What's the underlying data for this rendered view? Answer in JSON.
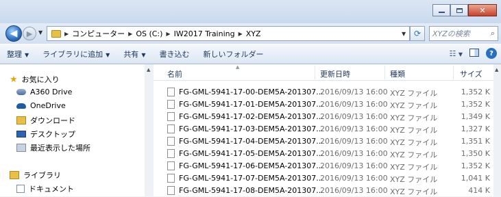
{
  "address": {
    "crumbs": [
      "コンピューター",
      "OS (C:)",
      "IW2017 Training",
      "XYZ"
    ],
    "search_placeholder": "XYZの検索"
  },
  "toolbar": {
    "organize": "整理",
    "add_to_library": "ライブラリに追加",
    "share": "共有",
    "burn": "書き込む",
    "new_folder": "新しいフォルダー"
  },
  "nav": {
    "favorites": "お気に入り",
    "a360": "A360 Drive",
    "onedrive": "OneDrive",
    "downloads": "ダウンロード",
    "desktop": "デスクトップ",
    "recent": "最近表示した場所",
    "libraries": "ライブラリ",
    "documents": "ドキュメント"
  },
  "columns": {
    "name": "名前",
    "modified": "更新日時",
    "type": "種類",
    "size": "サイズ"
  },
  "files": [
    {
      "name": "FG-GML-5941-17-00-DEM5A-201307...",
      "modified": "2016/09/13 16:00",
      "type": "XYZ ファイル",
      "size": "1,352 K"
    },
    {
      "name": "FG-GML-5941-17-01-DEM5A-201307...",
      "modified": "2016/09/13 16:00",
      "type": "XYZ ファイル",
      "size": "1,352 K"
    },
    {
      "name": "FG-GML-5941-17-02-DEM5A-201307...",
      "modified": "2016/09/13 16:00",
      "type": "XYZ ファイル",
      "size": "1,349 K"
    },
    {
      "name": "FG-GML-5941-17-03-DEM5A-201307...",
      "modified": "2016/09/13 16:00",
      "type": "XYZ ファイル",
      "size": "1,327 K"
    },
    {
      "name": "FG-GML-5941-17-04-DEM5A-201307...",
      "modified": "2016/09/13 16:00",
      "type": "XYZ ファイル",
      "size": "1,351 K"
    },
    {
      "name": "FG-GML-5941-17-05-DEM5A-201307...",
      "modified": "2016/09/13 16:00",
      "type": "XYZ ファイル",
      "size": "1,350 K"
    },
    {
      "name": "FG-GML-5941-17-06-DEM5A-201307...",
      "modified": "2016/09/13 16:00",
      "type": "XYZ ファイル",
      "size": "1,352 K"
    },
    {
      "name": "FG-GML-5941-17-07-DEM5A-201307...",
      "modified": "2016/09/13 16:00",
      "type": "XYZ ファイル",
      "size": "1,041 K"
    },
    {
      "name": "FG-GML-5941-17-08-DEM5A-201307...",
      "modified": "2016/09/13 16:00",
      "type": "XYZ ファイル",
      "size": "414 K"
    }
  ]
}
